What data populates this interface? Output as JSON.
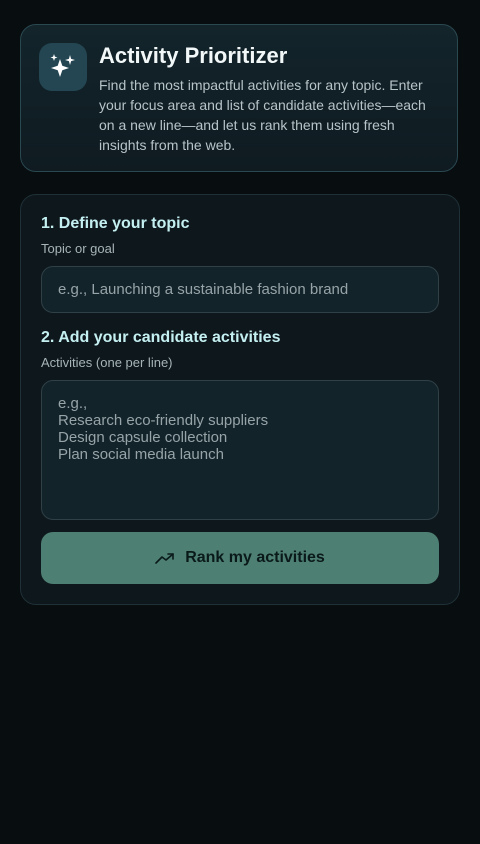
{
  "header": {
    "icon": "sparkles-icon",
    "title": "Activity Prioritizer",
    "description": "Find the most impactful activities for any topic. Enter your focus area and list of candidate activities—each on a new line—and let us rank them using fresh insights from the web."
  },
  "form": {
    "topic_section_title": "1. Define your topic",
    "topic_label": "Topic or goal",
    "topic_placeholder": "e.g., Launching a sustainable fashion brand",
    "topic_value": "",
    "activities_section_title": "2. Add your candidate activities",
    "activities_label": "Activities (one per line)",
    "activities_placeholder": "e.g.,\nResearch eco-friendly suppliers\nDesign capsule collection\nPlan social media launch",
    "activities_value": "",
    "submit_icon": "trending-up-icon",
    "submit_label": "Rank my activities"
  },
  "colors": {
    "background": "#080d10",
    "card": "#0d171c",
    "accent": "#4e7f73",
    "section_title": "#c5f0f2"
  }
}
